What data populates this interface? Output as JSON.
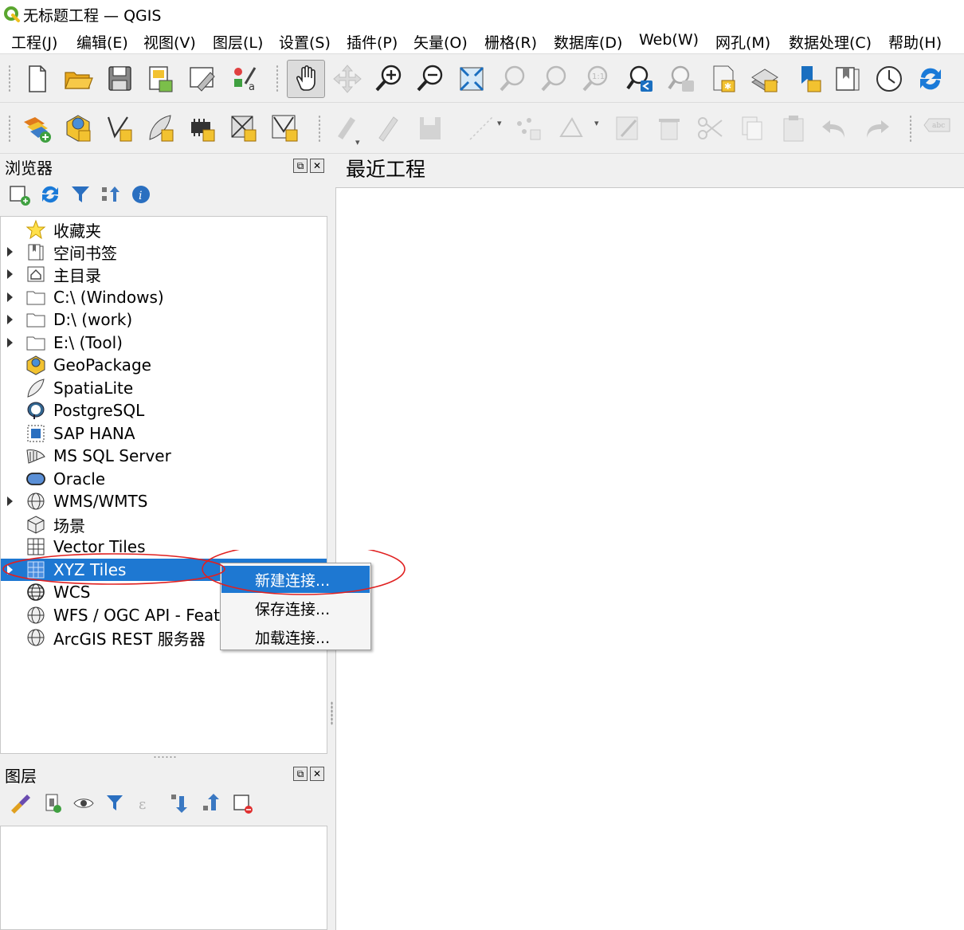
{
  "window": {
    "title": "无标题工程 — QGIS"
  },
  "menu": [
    "工程(J)",
    "编辑(E)",
    "视图(V)",
    "图层(L)",
    "设置(S)",
    "插件(P)",
    "矢量(O)",
    "栅格(R)",
    "数据库(D)",
    "Web(W)",
    "网孔(M)",
    "数据处理(C)",
    "帮助(H)"
  ],
  "toolbar1": [
    "new-project-icon",
    "open-project-icon",
    "save-project-icon",
    "print-layout-icon",
    "layout-manager-icon",
    "style-manager-icon",
    "pan-icon",
    "pan-to-selection-icon",
    "zoom-in-icon",
    "zoom-out-icon",
    "zoom-full-icon",
    "zoom-selection-icon",
    "zoom-layer-icon",
    "zoom-native-icon",
    "zoom-last-icon",
    "zoom-next-icon",
    "new-bookmark-icon",
    "show-bookmarks-icon",
    "new-spatial-bookmark-icon",
    "spatial-bookmarks-icon",
    "temporal-controller-icon",
    "refresh-icon"
  ],
  "toolbar2": [
    "data-source-manager-icon",
    "new-geopackage-layer-icon",
    "new-shapefile-layer-icon",
    "new-spatialite-layer-icon",
    "new-temporary-layer-icon",
    "new-virtual-layer-icon",
    "new-mesh-layer-icon",
    "current-edits-icon",
    "toggle-editing-icon",
    "save-edits-icon",
    "digitize-icon",
    "add-point-icon",
    "vertex-tool-icon",
    "modify-attributes-icon",
    "delete-selected-icon",
    "cut-features-icon",
    "copy-features-icon",
    "paste-features-icon",
    "undo-icon",
    "redo-icon",
    "label-icon"
  ],
  "browser": {
    "title": "浏览器",
    "tools": [
      "add-selected-layers-icon",
      "refresh-icon",
      "filter-icon",
      "collapse-all-icon",
      "properties-icon"
    ],
    "items": [
      {
        "label": "收藏夹",
        "icon": "favorites-star-icon",
        "expandable": false
      },
      {
        "label": "空间书签",
        "icon": "spatial-bookmarks-icon",
        "expandable": true
      },
      {
        "label": "主目录",
        "icon": "home-folder-icon",
        "expandable": true
      },
      {
        "label": "C:\\ (Windows)",
        "icon": "folder-icon",
        "expandable": true
      },
      {
        "label": "D:\\ (work)",
        "icon": "folder-icon",
        "expandable": true
      },
      {
        "label": "E:\\ (Tool)",
        "icon": "folder-icon",
        "expandable": true
      },
      {
        "label": "GeoPackage",
        "icon": "geopackage-icon",
        "expandable": false
      },
      {
        "label": "SpatiaLite",
        "icon": "spatialite-icon",
        "expandable": false
      },
      {
        "label": "PostgreSQL",
        "icon": "postgresql-icon",
        "expandable": false
      },
      {
        "label": "SAP HANA",
        "icon": "sap-hana-icon",
        "expandable": false
      },
      {
        "label": "MS SQL Server",
        "icon": "mssql-icon",
        "expandable": false
      },
      {
        "label": "Oracle",
        "icon": "oracle-icon",
        "expandable": false
      },
      {
        "label": "WMS/WMTS",
        "icon": "wms-globe-icon",
        "expandable": true
      },
      {
        "label": "场景",
        "icon": "scene-icon",
        "expandable": false
      },
      {
        "label": "Vector Tiles",
        "icon": "vector-tiles-icon",
        "expandable": false
      },
      {
        "label": "XYZ Tiles",
        "icon": "xyz-tiles-icon",
        "expandable": true,
        "selected": true
      },
      {
        "label": "WCS",
        "icon": "wcs-globe-icon",
        "expandable": false
      },
      {
        "label": "WFS / OGC API - Featu",
        "icon": "wfs-globe-icon",
        "expandable": false
      },
      {
        "label": "ArcGIS REST 服务器",
        "icon": "arcgis-globe-icon",
        "expandable": false
      }
    ]
  },
  "layers": {
    "title": "图层",
    "tools": [
      "style-panel-icon",
      "add-group-icon",
      "visibility-icon",
      "filter-legend-icon",
      "filter-expression-icon",
      "expand-all-icon",
      "collapse-all-icon",
      "remove-layer-icon"
    ]
  },
  "recent": {
    "title": "最近工程"
  },
  "context_menu": {
    "items": [
      {
        "label": "新建连接...",
        "active": true
      },
      {
        "label": "保存连接...",
        "active": false
      },
      {
        "label": "加载连接...",
        "active": false
      }
    ]
  },
  "colors": {
    "selection": "#1e78d2",
    "annotation": "#e02020",
    "qgis_green": "#5aa62f"
  }
}
